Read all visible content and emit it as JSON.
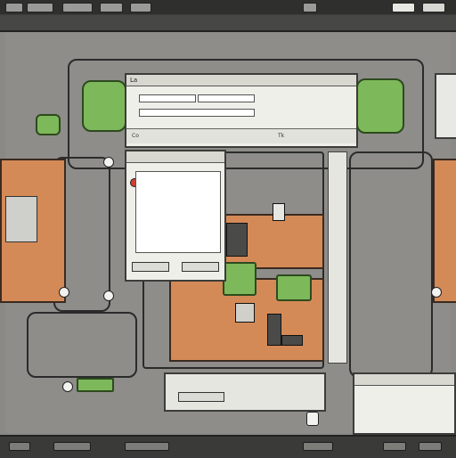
{
  "window": {
    "title": ""
  },
  "menubar": {
    "items": [
      "",
      "",
      "",
      "",
      "",
      ""
    ]
  },
  "toolbar": {
    "tools": [
      "",
      "",
      "",
      "",
      "",
      "",
      "",
      "",
      "",
      "",
      ""
    ]
  },
  "dialog_main": {
    "title": "La",
    "fields": [
      "",
      "",
      ""
    ],
    "tab_label": "Co",
    "value_label": "Tk"
  },
  "dialog_list": {
    "title": "",
    "items": [
      "",
      "",
      "",
      "",
      "",
      "",
      ""
    ],
    "ok_label": "",
    "cancel_label": ""
  },
  "dialog_bottom": {
    "title": "",
    "button_label": ""
  },
  "colors": {
    "board_orange": "#d48a57",
    "board_green": "#7db85a",
    "chrome_dark": "#3d3d3b",
    "panel_bg": "#efefe9"
  },
  "icons": [
    "close-icon",
    "chip-icon",
    "pad-icon",
    "scroll-icon"
  ]
}
